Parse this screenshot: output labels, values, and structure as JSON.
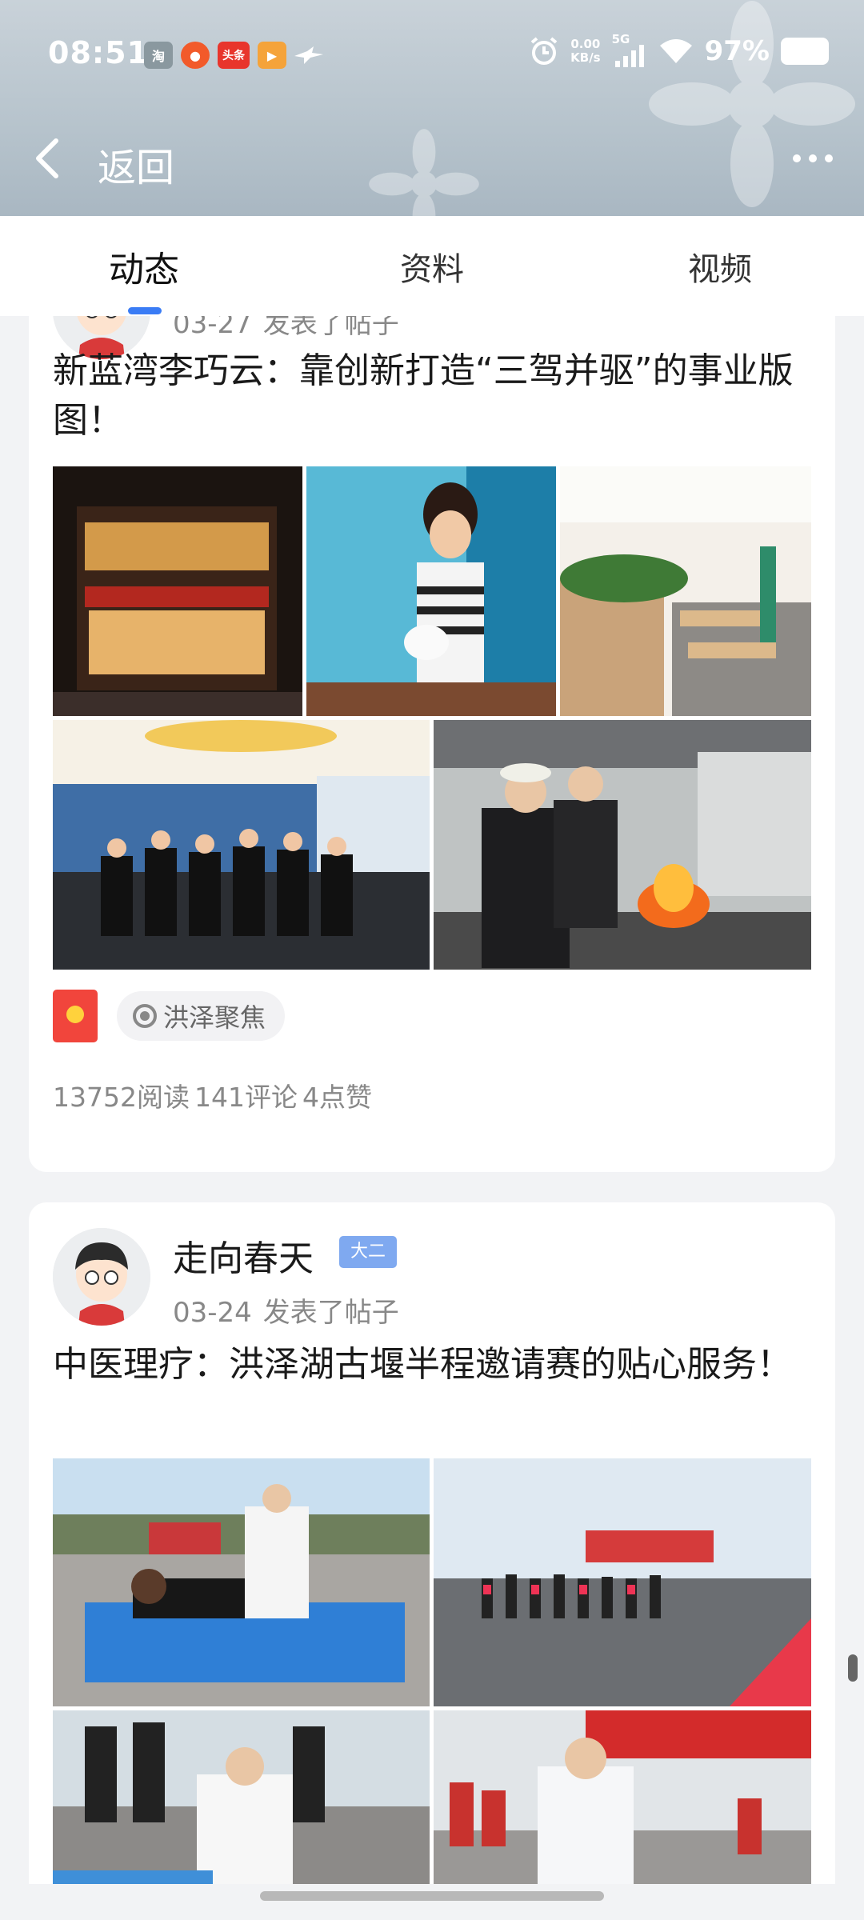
{
  "status_bar": {
    "time": "08:51",
    "notifications": [
      {
        "label": "淘",
        "color": "#7b8a92"
      },
      {
        "label": "●",
        "color": "#f25a2a"
      },
      {
        "label": "头条",
        "color": "#e8352c"
      },
      {
        "label": "▶",
        "color": "#f5a33a"
      }
    ],
    "speed_top": "0.00",
    "speed_bottom": "KB/s",
    "network": "5G",
    "battery": "97%"
  },
  "nav": {
    "back_label": "返回"
  },
  "tabs": [
    {
      "label": "动态",
      "active": true
    },
    {
      "label": "资料",
      "active": false
    },
    {
      "label": "视频",
      "active": false
    }
  ],
  "posts": [
    {
      "date": "03-27",
      "action": "发表了帖子",
      "title": "新蓝湾李巧云：靠创新打造“三驾并驱”的事业版图！",
      "tag": "洪泽聚焦",
      "stats": {
        "reads": "13752阅读",
        "comments": "141评论",
        "likes": "4点赞"
      }
    },
    {
      "author": "走向春天",
      "badge": "大二",
      "date": "03-24",
      "action": "发表了帖子",
      "title": "中医理疗：洪泽湖古堰半程邀请赛的贴心服务！"
    }
  ],
  "colors": {
    "accent": "#3a7cf5",
    "red_packet": "#f1453c",
    "badge": "#7fa9f0"
  }
}
